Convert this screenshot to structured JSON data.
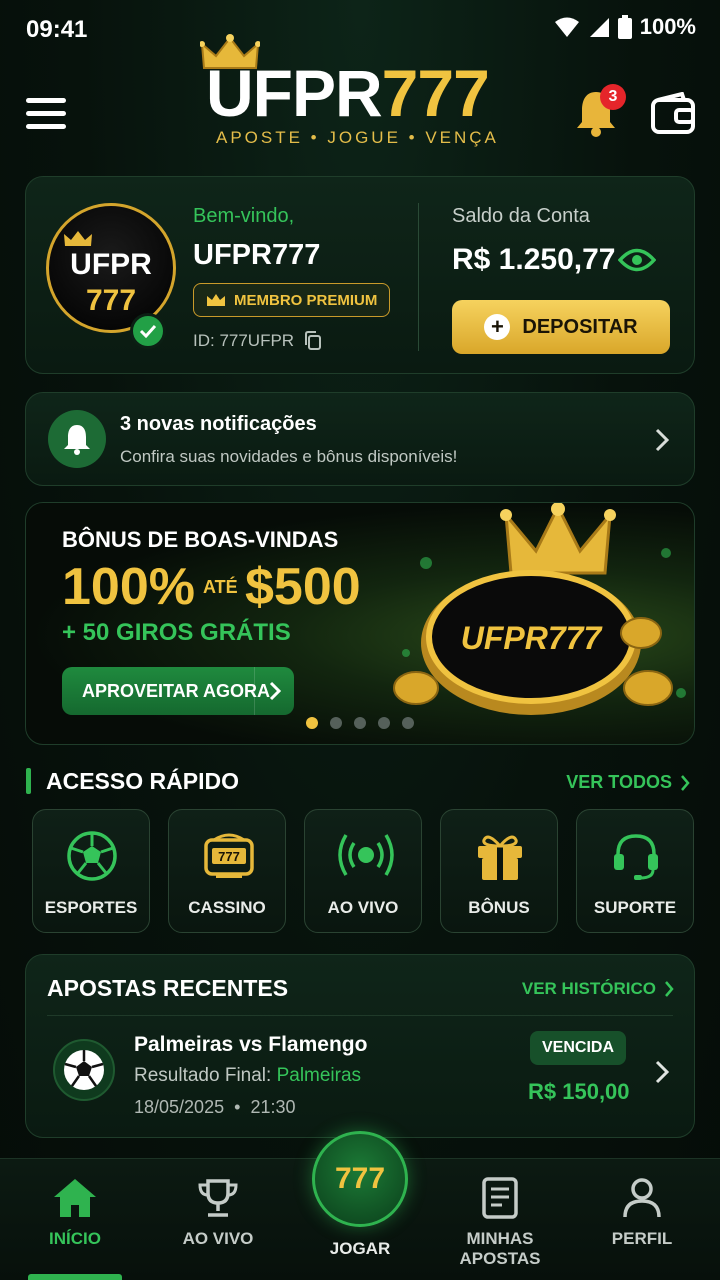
{
  "status_bar": {
    "time": "09:41",
    "battery": "100%"
  },
  "header": {
    "logo_main": "UFPR",
    "logo_num": "777",
    "tagline": "APOSTE • JOGUE • VENÇA",
    "notification_count": "3"
  },
  "profile": {
    "avatar_line1": "UFPR",
    "avatar_line2": "777",
    "welcome": "Bem-vindo,",
    "username": "UFPR777",
    "membership": "MEMBRO PREMIUM",
    "user_id": "ID: 777UFPR",
    "balance_label": "Saldo da Conta",
    "balance_value": "R$ 1.250,77",
    "deposit_label": "DEPOSITAR"
  },
  "notifications": {
    "title": "3 novas notificações",
    "subtitle": "Confira suas novidades e bônus disponíveis!"
  },
  "banner": {
    "title": "BÔNUS DE BOAS-VINDAS",
    "percent": "100%",
    "ate": "ATÉ",
    "amount": "$500",
    "spins": "+ 50 GIROS GRÁTIS",
    "cta": "APROVEITAR AGORA",
    "logo_text": "UFPR777",
    "slides": 5,
    "active_slide": 0
  },
  "quick_access": {
    "title": "ACESSO RÁPIDO",
    "see_all": "VER TODOS",
    "items": [
      {
        "label": "ESPORTES",
        "icon": "soccer-ball-icon"
      },
      {
        "label": "CASSINO",
        "icon": "slot-machine-icon"
      },
      {
        "label": "AO VIVO",
        "icon": "live-broadcast-icon"
      },
      {
        "label": "BÔNUS",
        "icon": "gift-icon"
      },
      {
        "label": "SUPORTE",
        "icon": "headset-icon"
      }
    ]
  },
  "recent_bets": {
    "title": "APOSTAS RECENTES",
    "history": "VER HISTÓRICO",
    "items": [
      {
        "match": "Palmeiras vs Flamengo",
        "result_label": "Resultado Final:",
        "result_value": "Palmeiras",
        "date": "18/05/2025",
        "time": "21:30",
        "date_sep": "•",
        "status": "VENCIDA",
        "amount": "R$ 150,00"
      }
    ]
  },
  "bottom_nav": {
    "items": [
      "INÍCIO",
      "AO VIVO",
      "JOGAR",
      "MINHAS APOSTAS",
      "PERFIL"
    ],
    "play_text": "777",
    "active": "INÍCIO"
  },
  "colors": {
    "accent_green": "#35c45a",
    "accent_gold": "#f0c340",
    "background": "#07120c"
  }
}
